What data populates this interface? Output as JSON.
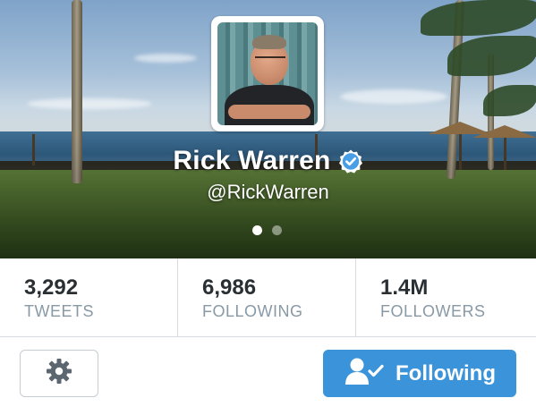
{
  "profile": {
    "name": "Rick Warren",
    "handle": "@RickWarren",
    "verified": true,
    "carousel_pages": 2,
    "carousel_active_page": 1
  },
  "stats": [
    {
      "value": "3,292",
      "label": "TWEETS"
    },
    {
      "value": "6,986",
      "label": "FOLLOWING"
    },
    {
      "value": "1.4M",
      "label": "FOLLOWERS"
    }
  ],
  "actions": {
    "settings_icon": "gear-icon",
    "follow_label": "Following",
    "follow_icon": "user-check-icon"
  },
  "colors": {
    "accent": "#3b94d9",
    "verified": "#4a9ee6",
    "stat_label": "#8899a6",
    "stat_value": "#292f33"
  }
}
